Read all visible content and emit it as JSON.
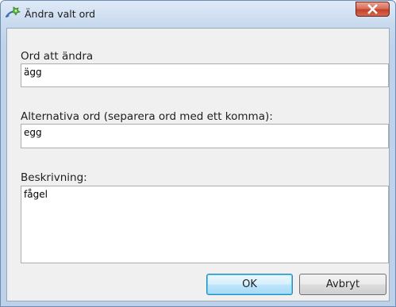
{
  "window": {
    "title": "Ändra valt ord",
    "close_symbol": "X"
  },
  "icons": {
    "app": "edit-word-icon",
    "close": "close-icon"
  },
  "form": {
    "word_label": "Ord att ändra",
    "word_value": "ägg",
    "alternatives_label": "Alternativa ord (separera ord med ett komma):",
    "alternatives_value": "egg",
    "description_label": "Beskrivning:",
    "description_value": "fågel"
  },
  "buttons": {
    "ok_label": "OK",
    "cancel_label": "Avbryt"
  },
  "colors": {
    "title_bar": "#c9daef",
    "close_button": "#c4412a",
    "ok_button_accent": "#3c7fb1"
  }
}
